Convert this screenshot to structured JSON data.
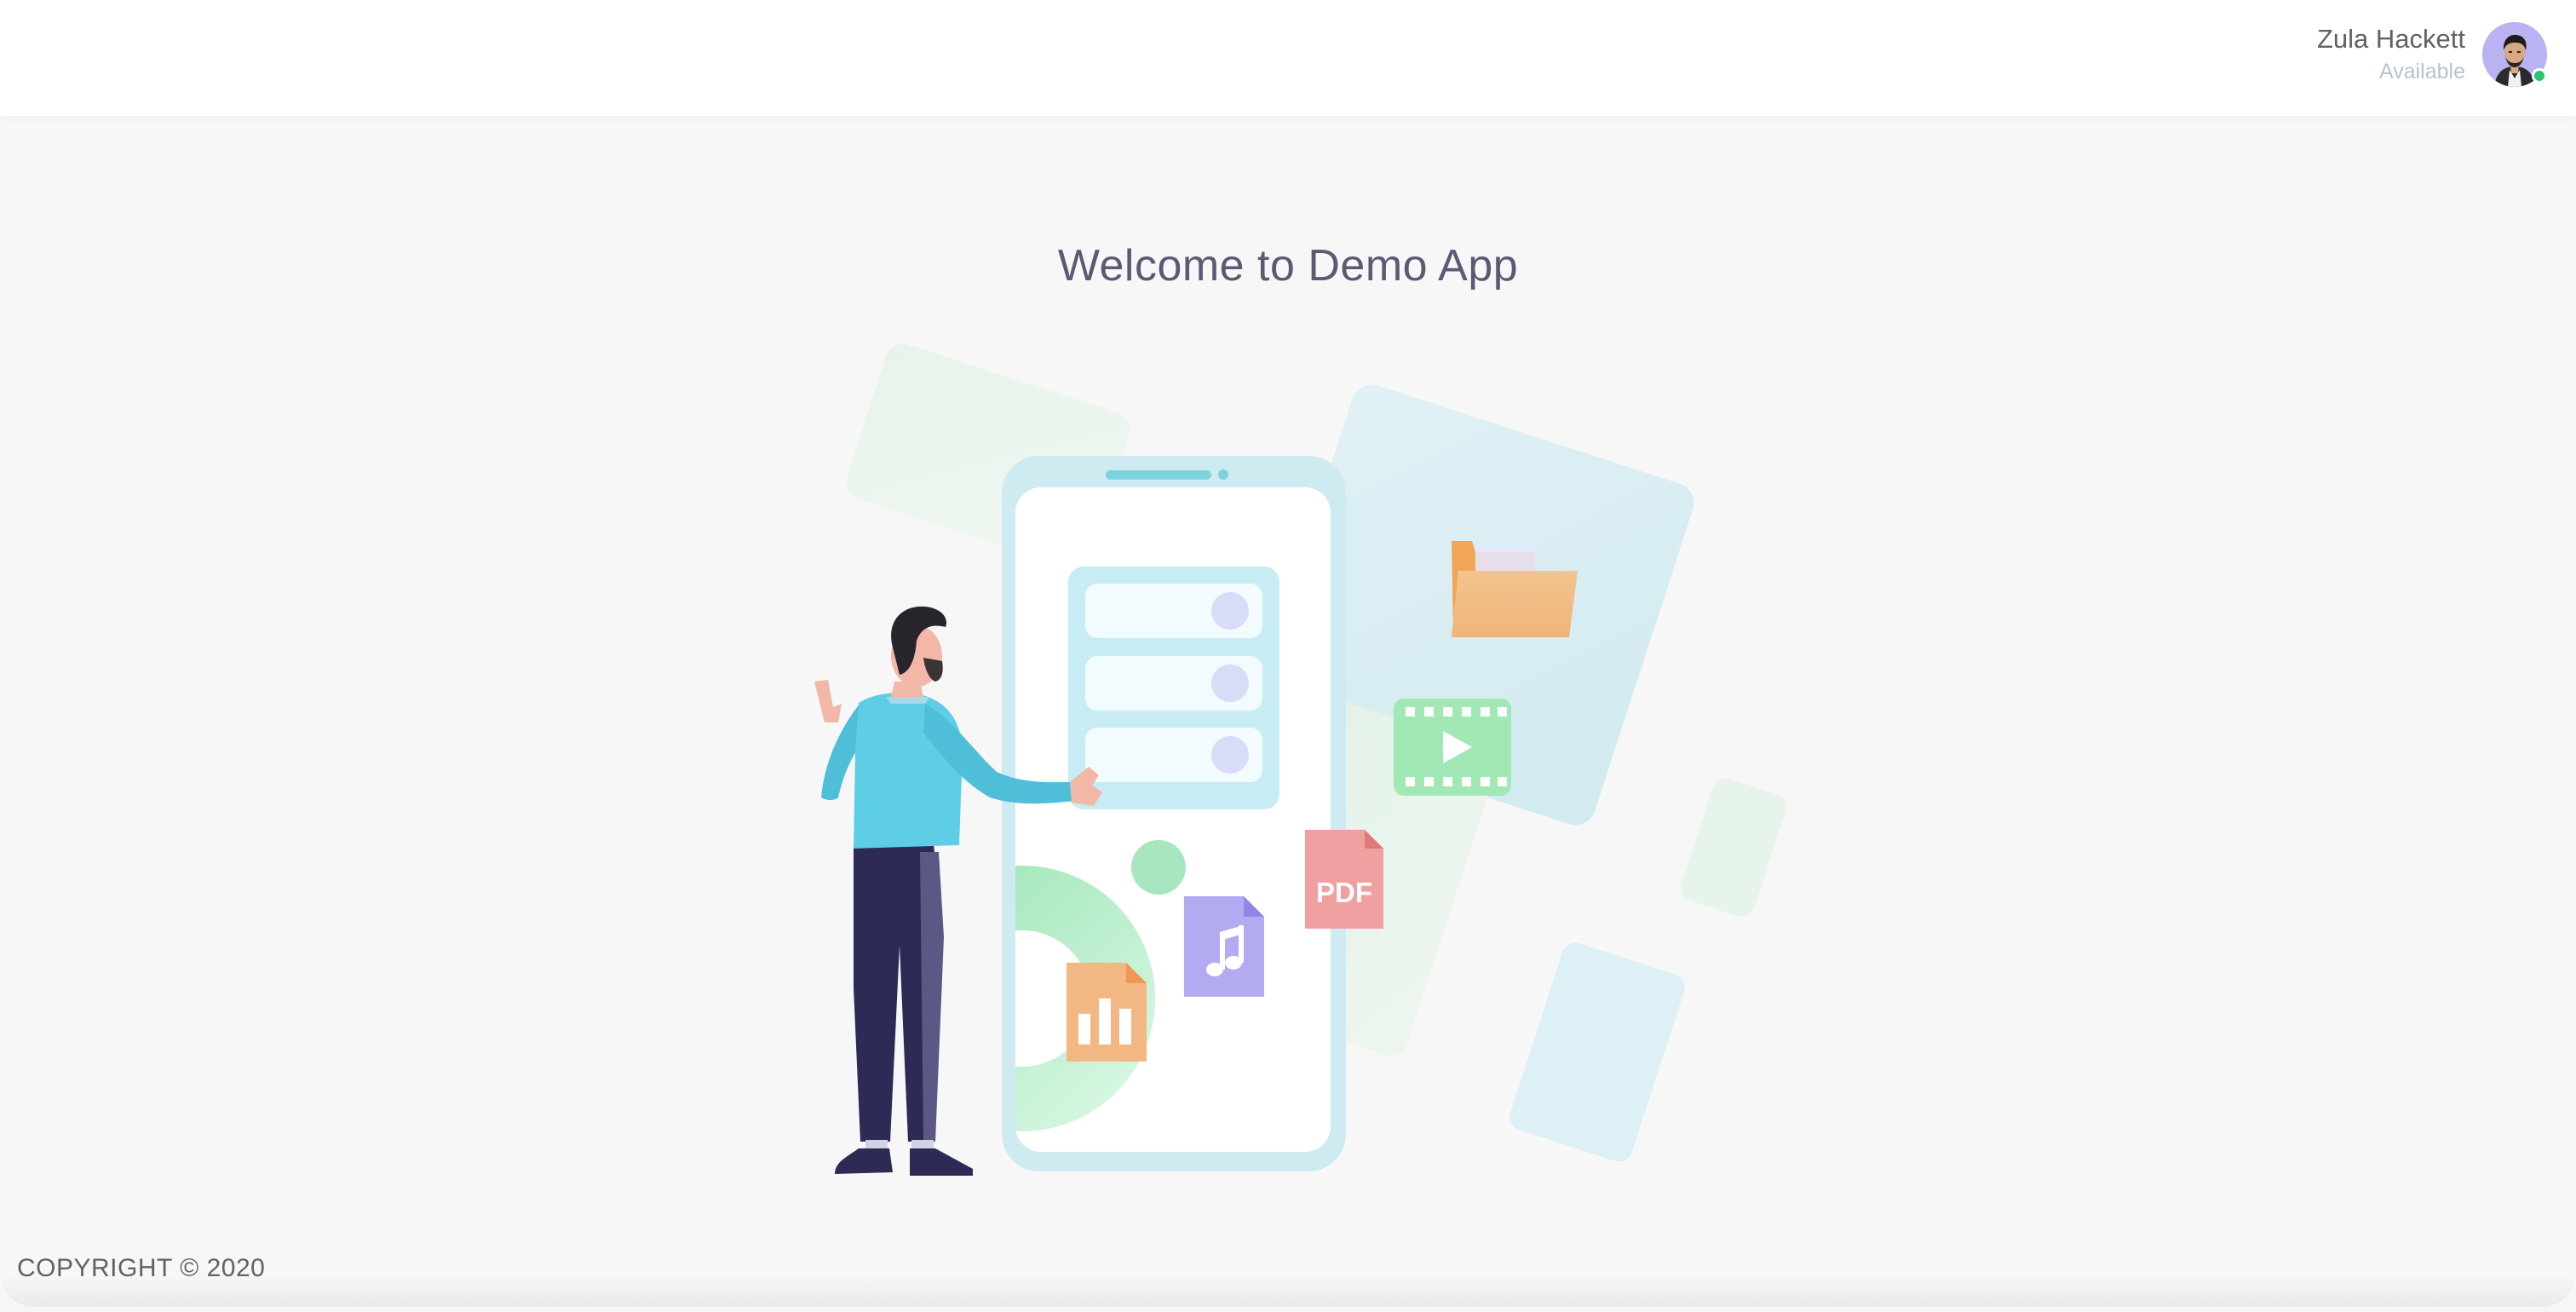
{
  "navbar": {
    "user_name": "Zula Hackett",
    "user_status": "Available",
    "status_color": "#28c76f"
  },
  "main": {
    "welcome_title": "Welcome to Demo App",
    "illustration": {
      "pdf_label": "PDF",
      "icons": [
        "folder-icon",
        "video-icon",
        "pdf-file-icon",
        "music-file-icon",
        "chart-file-icon"
      ]
    }
  },
  "footer": {
    "copyright": "COPYRIGHT © 2020"
  },
  "colors": {
    "background": "#f7f7f7",
    "navbar": "#ffffff",
    "title": "#5e5873",
    "person_shirt": "#5ecde6",
    "person_pants": "#2e2a56",
    "phone_frame": "#cdebf1"
  }
}
